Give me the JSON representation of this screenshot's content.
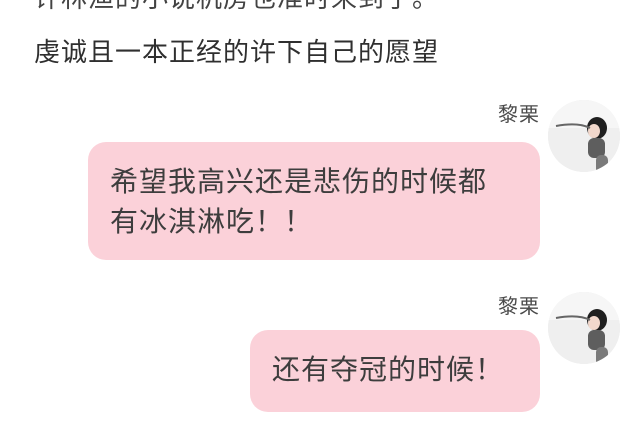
{
  "context": {
    "line_cut": "许林渔的小说机房也准时来到了。",
    "line": "虔诚且一本正经的许下自己的愿望"
  },
  "messages": [
    {
      "sender": "黎栗",
      "text_line1": "希望我高兴还是悲伤的时候都",
      "text_line2": "有冰淇淋吃！！",
      "avatar": "profile-photo"
    },
    {
      "sender": "黎栗",
      "text_line1": "还有夺冠的时候！",
      "avatar": "profile-photo"
    }
  ],
  "colors": {
    "bubble": "#fbd1d9",
    "text": "#333333"
  }
}
